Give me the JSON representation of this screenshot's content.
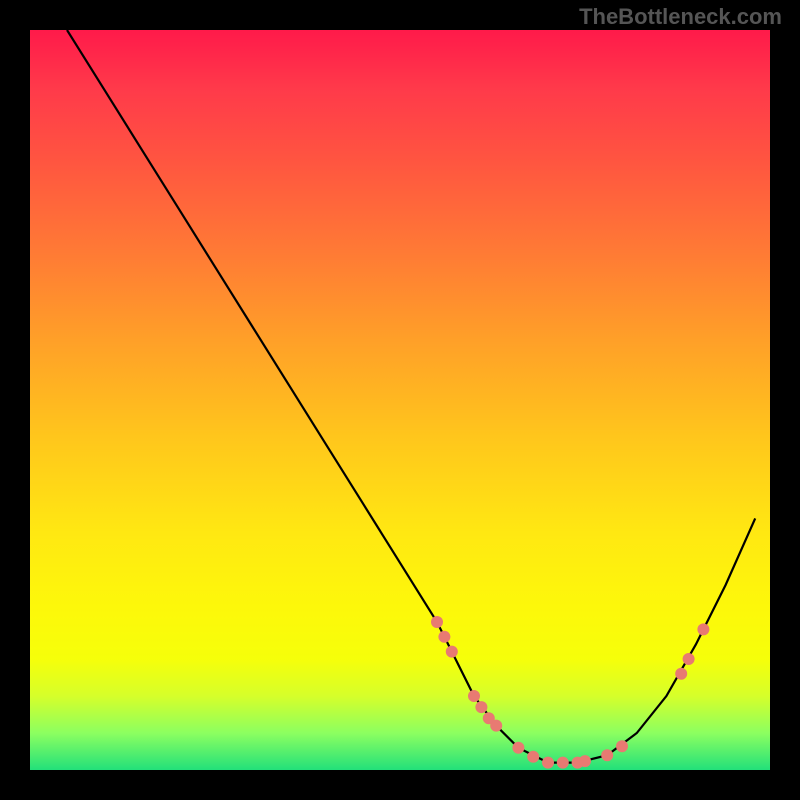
{
  "watermark": "TheBottleneck.com",
  "chart_data": {
    "type": "line",
    "title": "",
    "xlabel": "",
    "ylabel": "",
    "xlim": [
      0,
      100
    ],
    "ylim": [
      0,
      100
    ],
    "series": [
      {
        "name": "curve",
        "x": [
          5,
          10,
          15,
          20,
          25,
          30,
          35,
          40,
          45,
          50,
          55,
          57,
          60,
          63,
          66,
          70,
          74,
          78,
          82,
          86,
          90,
          94,
          98
        ],
        "values": [
          100,
          92,
          84,
          76,
          68,
          60,
          52,
          44,
          36,
          28,
          20,
          16,
          10,
          6,
          3,
          1,
          1,
          2,
          5,
          10,
          17,
          25,
          34
        ]
      }
    ],
    "markers": [
      {
        "x": 55,
        "y": 20
      },
      {
        "x": 56,
        "y": 18
      },
      {
        "x": 57,
        "y": 16
      },
      {
        "x": 60,
        "y": 10
      },
      {
        "x": 61,
        "y": 8.5
      },
      {
        "x": 62,
        "y": 7
      },
      {
        "x": 63,
        "y": 6
      },
      {
        "x": 66,
        "y": 3
      },
      {
        "x": 68,
        "y": 1.8
      },
      {
        "x": 70,
        "y": 1
      },
      {
        "x": 72,
        "y": 1
      },
      {
        "x": 74,
        "y": 1
      },
      {
        "x": 75,
        "y": 1.2
      },
      {
        "x": 78,
        "y": 2
      },
      {
        "x": 80,
        "y": 3.2
      },
      {
        "x": 88,
        "y": 13
      },
      {
        "x": 89,
        "y": 15
      },
      {
        "x": 91,
        "y": 19
      }
    ],
    "gradient_stops": [
      {
        "pct": 0,
        "color": "#ff1a4a"
      },
      {
        "pct": 8,
        "color": "#ff3a4a"
      },
      {
        "pct": 18,
        "color": "#ff5640"
      },
      {
        "pct": 30,
        "color": "#ff7a35"
      },
      {
        "pct": 42,
        "color": "#ffa028"
      },
      {
        "pct": 55,
        "color": "#ffc61c"
      },
      {
        "pct": 68,
        "color": "#ffe812"
      },
      {
        "pct": 78,
        "color": "#fdf80a"
      },
      {
        "pct": 85,
        "color": "#f6ff0a"
      },
      {
        "pct": 90,
        "color": "#d6ff2a"
      },
      {
        "pct": 95,
        "color": "#8cff60"
      },
      {
        "pct": 100,
        "color": "#22e07a"
      }
    ]
  }
}
